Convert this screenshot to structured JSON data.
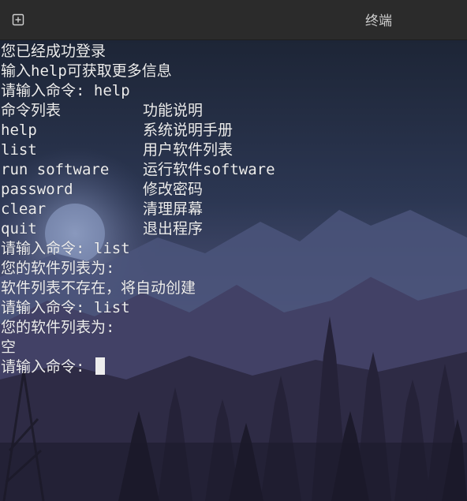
{
  "window": {
    "title": "终端",
    "new_tab_icon": "plus-box-icon"
  },
  "terminal": {
    "lines": [
      "您已经成功登录",
      "输入help可获取更多信息",
      "请输入命令: help"
    ],
    "help_table": [
      {
        "cmd": "命令列表",
        "desc": "功能说明"
      },
      {
        "cmd": "help",
        "desc": "系统说明手册"
      },
      {
        "cmd": "list",
        "desc": "用户软件列表"
      },
      {
        "cmd": "run software",
        "desc": "运行软件software"
      },
      {
        "cmd": "password",
        "desc": "修改密码"
      },
      {
        "cmd": "clear",
        "desc": "清理屏幕"
      },
      {
        "cmd": "quit",
        "desc": "退出程序"
      }
    ],
    "after_lines": [
      "请输入命令: list",
      "您的软件列表为:",
      "软件列表不存在，将自动创建",
      "请输入命令: list",
      "您的软件列表为:",
      "空"
    ],
    "prompt": "请输入命令: "
  },
  "colors": {
    "text": "#ededed",
    "titlebar": "#2b2b2b",
    "sky_top": "#1c2333",
    "sky_bottom": "#4a4f78",
    "moon": "#8f9fc2"
  }
}
